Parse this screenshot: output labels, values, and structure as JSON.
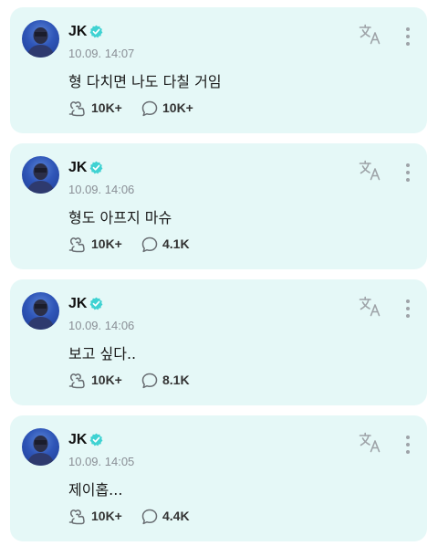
{
  "theme": {
    "card_bg": "#e5f8f7",
    "verified_color": "#3fd2d2",
    "meta_color": "#8a8f96"
  },
  "icons": {
    "verified": "verified-badge-icon",
    "translate": "translate-icon",
    "more": "more-vertical-icon",
    "like": "like-icon",
    "comment": "comment-icon"
  },
  "posts": [
    {
      "author": "JK",
      "time": "10.09. 14:07",
      "text": "형 다치면 나도 다칠 거임",
      "likes": "10K+",
      "comments": "10K+"
    },
    {
      "author": "JK",
      "time": "10.09. 14:06",
      "text": "형도 아프지 마슈",
      "likes": "10K+",
      "comments": "4.1K"
    },
    {
      "author": "JK",
      "time": "10.09. 14:06",
      "text": "보고 싶다..",
      "likes": "10K+",
      "comments": "8.1K"
    },
    {
      "author": "JK",
      "time": "10.09. 14:05",
      "text": "제이홉...",
      "likes": "10K+",
      "comments": "4.4K"
    }
  ]
}
